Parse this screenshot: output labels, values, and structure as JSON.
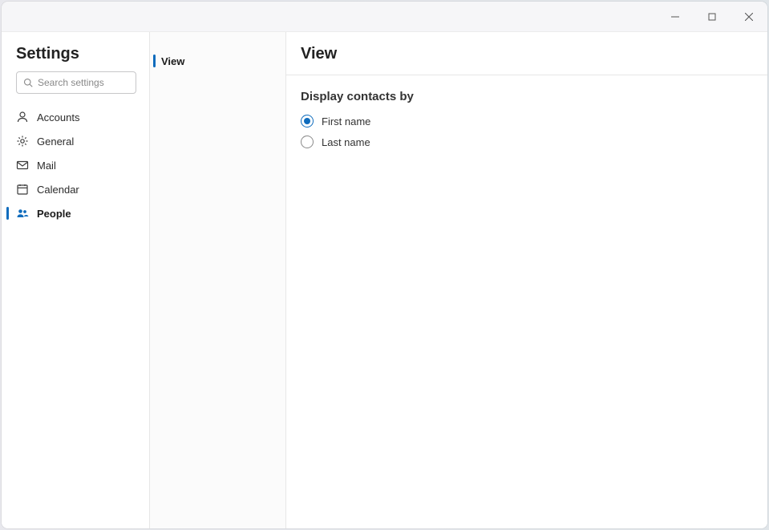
{
  "window": {
    "controls": {
      "minimize": "minimize",
      "maximize": "maximize",
      "close": "close"
    }
  },
  "col1": {
    "title": "Settings",
    "search_placeholder": "Search settings",
    "nav": [
      {
        "id": "accounts",
        "label": "Accounts",
        "selected": false
      },
      {
        "id": "general",
        "label": "General",
        "selected": false
      },
      {
        "id": "mail",
        "label": "Mail",
        "selected": false
      },
      {
        "id": "calendar",
        "label": "Calendar",
        "selected": false
      },
      {
        "id": "people",
        "label": "People",
        "selected": true
      }
    ]
  },
  "col2": {
    "items": [
      {
        "id": "view",
        "label": "View",
        "selected": true
      }
    ]
  },
  "col3": {
    "title": "View",
    "section_title": "Display contacts by",
    "options": [
      {
        "id": "first-name",
        "label": "First name",
        "selected": true
      },
      {
        "id": "last-name",
        "label": "Last name",
        "selected": false
      }
    ]
  }
}
